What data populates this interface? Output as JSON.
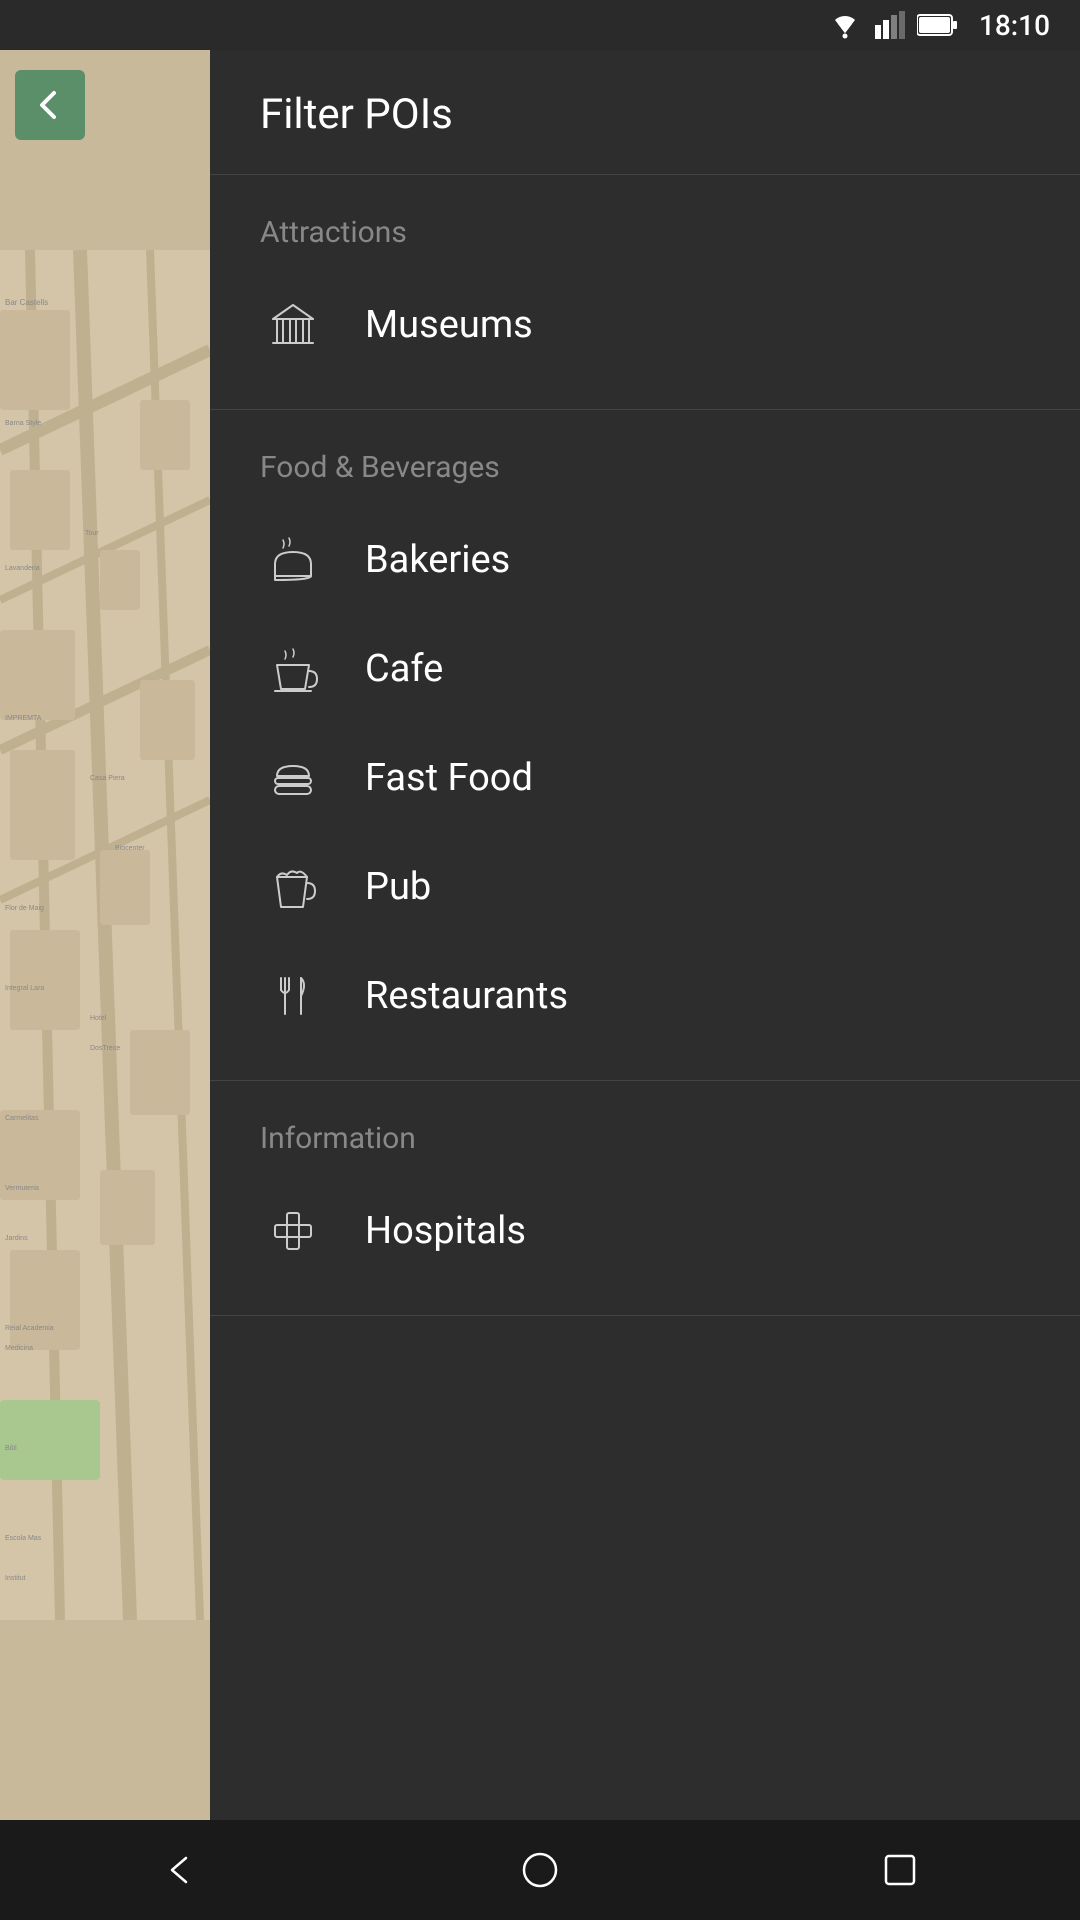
{
  "statusBar": {
    "time": "18:10"
  },
  "header": {
    "title": "Filter POIs"
  },
  "backButton": {
    "label": "←"
  },
  "sections": [
    {
      "id": "attractions",
      "title": "Attractions",
      "items": [
        {
          "id": "museums",
          "label": "Museums",
          "icon": "museum"
        }
      ]
    },
    {
      "id": "food-beverages",
      "title": "Food & Beverages",
      "items": [
        {
          "id": "bakeries",
          "label": "Bakeries",
          "icon": "bakery"
        },
        {
          "id": "cafe",
          "label": "Cafe",
          "icon": "cafe"
        },
        {
          "id": "fast-food",
          "label": "Fast Food",
          "icon": "fastfood"
        },
        {
          "id": "pub",
          "label": "Pub",
          "icon": "pub"
        },
        {
          "id": "restaurants",
          "label": "Restaurants",
          "icon": "restaurant"
        }
      ]
    },
    {
      "id": "information",
      "title": "Information",
      "items": [
        {
          "id": "hospitals",
          "label": "Hospitals",
          "icon": "hospital"
        }
      ]
    }
  ],
  "navBar": {
    "back": "◁",
    "home": "○",
    "recent": "□"
  }
}
